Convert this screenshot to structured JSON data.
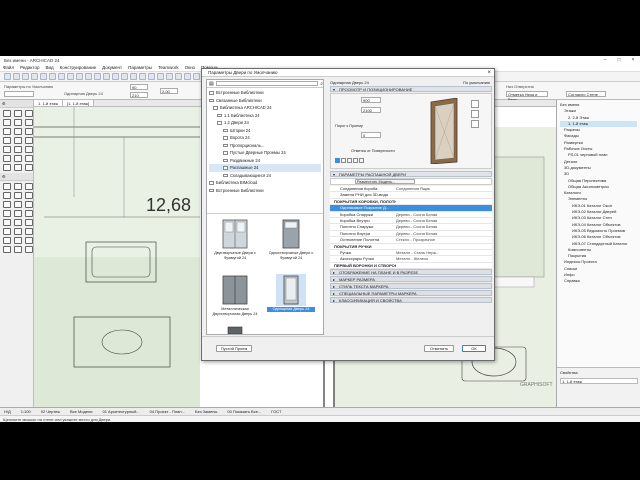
{
  "window": {
    "title": "Без имени - ARCHICAD 24"
  },
  "menu": [
    "Файл",
    "Редактор",
    "Вид",
    "Конструирование",
    "Документ",
    "Параметры",
    "Teamwork",
    "Окно",
    "Помощь"
  ],
  "infobox": {
    "main_label": "Параметры по Умолчанию",
    "door_name": "Одинарная Дверь 24",
    "field_a": "90",
    "field_b": "210",
    "field_c": "2,00",
    "elevation": "Низ Отверстия",
    "reveal": "1.1 Ограждение",
    "layer": "Отметка Низа и Верх...",
    "surface": "Согласно Стене",
    "hint": "Щелкните мышью на стене или укажите место для Двери."
  },
  "canvas": {
    "tab1": "1. 1-й этаж",
    "tab2": "[1. 1-й этаж]",
    "dimension": "12,68",
    "watermark": "GRAPHISOFT"
  },
  "dialog": {
    "title": "Параметры Двери по Умолчанию",
    "object_name": "Одинарная Дверь 24",
    "default_label": "По умолчанию",
    "lib_tree": [
      "Встроенные Библиотеки",
      "Связанные Библиотеки",
      "Библиотека ARCHICAD 24",
      "1.1 Библиотека 24",
      "1.2 Двери 24",
      "Шторки 24",
      "Ворота 24",
      "Пропорциональ...",
      "Пустые Дверные Проемы 24",
      "Раздвижные 24",
      "Распашные 24",
      "Складывающиеся 24",
      "Библиотека BIMcloud",
      "Встроенные Библиотеки"
    ],
    "thumbs": [
      "Двустворчатые Двери с Фрамугой 24",
      "Одностворчатые Двери с Фрамугой 24",
      "Металлическая Двухстворчатая Дверь 24",
      "Одинарная Дверь 24"
    ],
    "sections": {
      "preview": "ПРОСМОТР И ПОЗИЦИОНИРОВАНИЕ",
      "params": "ПАРАМЕТРЫ РАСПАШНОЙ ДВЕРИ",
      "floor_plan": "ОТОБРАЖЕНИЕ НА ПЛАНЕ И В РАЗРЕЗЕ",
      "marker": "МАРКЕР РАЗМЕРА",
      "marker_style": "СТИЛЬ ТЕКСТА МАРКЕРА",
      "special": "СПЕЦИАЛЬНЫЕ ПАРАМЕТРЫ МАРКЕРА",
      "classification": "КЛАССИФИКАЦИЯ И СВОЙСТВА"
    },
    "dims": {
      "width": "900",
      "height": "2100",
      "sill": "0",
      "sill_label": "Порог к Проему",
      "anchor_label": "Отметка от Поверхности"
    },
    "param_rows": [
      {
        "name": "Соединения Короба",
        "value": "Соединения Ящик"
      },
      {
        "name": "Замена РНИ для 3D-вида",
        "value": ""
      },
      {
        "name": "ПОКРЫТИЯ КОРОБКИ, ПОЛОТНА И СТВОРКИ",
        "value": "",
        "group": true
      },
      {
        "name": "Одинаковое Покрытие Д...",
        "value": "",
        "sel": true
      },
      {
        "name": "Коробка Снаружи",
        "value": "Дерево - Сосна Белая"
      },
      {
        "name": "Коробка Внутри",
        "value": "Дерево - Сосна Белая"
      },
      {
        "name": "Полотно Снаружи",
        "value": "Дерево - Сосна Белая"
      },
      {
        "name": "Полотно Внутри",
        "value": "Дерево - Сосна Белая"
      },
      {
        "name": "Остекление Полотна",
        "value": "Стекло - Прозрачное"
      },
      {
        "name": "ПОКРЫТИЯ РУЧКИ",
        "value": "",
        "group": true
      },
      {
        "name": "Ручка",
        "value": "Металл - Сталь Нерж..."
      },
      {
        "name": "Аксессуары Ручки",
        "value": "Металл - Железо"
      },
      {
        "name": "ПЕРВЫЙ ВОРОНКИ И СТВОРОК (0-10)",
        "value": "",
        "group": true
      }
    ],
    "surface_btn": "Разместить Модель...",
    "clear_btn": "Пустой Проем",
    "cancel_btn": "Отменить",
    "ok_btn": "ОК"
  },
  "navigator": {
    "items": [
      "Без имени",
      "Этажи",
      "2. 2-й Этаж",
      "1. 1-й этаж",
      "Разрезы",
      "Фасады",
      "Развертки",
      "Рабочие Листы",
      "РЛ-01 черновой план",
      "Детали",
      "3D-документы",
      "3D",
      "Общая Перспектива",
      "Общая Аксонометрия",
      "Каталоги",
      "Элементы",
      "ИКЭ-01 Каталог Окон",
      "ИКЭ-02 Каталог Дверей",
      "ИКЭ-03 Каталог Стен",
      "ИКЭ-04 Каталог Объектов",
      "ИКЭ-05 Ведомость Проемов",
      "ИКЭ-06 Каталог Объектов",
      "ИКЭ-07 Стандартный Каталог",
      "Компоненты",
      "Покрытия",
      "Индексы Проекта",
      "Списки",
      "Инфо",
      "Справка"
    ],
    "bottom_title": "Свойства",
    "bottom_value": "1. 1-й этаж"
  },
  "viewbar": [
    "Н/Д",
    "1:100",
    "02 Чертеж",
    "Все Модели",
    "01 Архитектурный...",
    "04 Проект - План...",
    "Без Замены",
    "00 Показать Все...",
    "ГОСТ"
  ],
  "statusbar": "Щелкните мышью на стене или укажите место для Двери."
}
